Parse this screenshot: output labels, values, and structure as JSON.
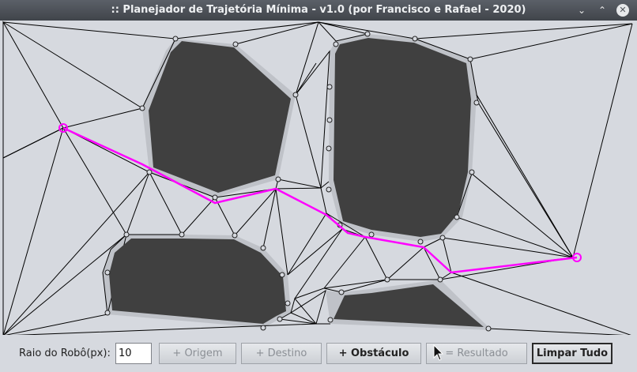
{
  "window": {
    "title": ":: Planejador de Trajetória Mínima - v1.0 (por Francisco e Rafael - 2020)",
    "minimize_glyph": "⌄",
    "maximize_glyph": "⌃",
    "close_glyph": "✕"
  },
  "toolbar": {
    "radius_label": "Raio do Robô(px):",
    "radius_value": "10",
    "origin_button": "+ Origem",
    "destination_button": "+ Destino",
    "obstacle_button": "+ Obstáculo",
    "result_button": "= Resultado",
    "clear_button": "Limpar Tudo"
  },
  "colors": {
    "obstacle_fill": "#404040",
    "obstacle_margin": "#bfc2c8",
    "path": "#ff00ff",
    "edges": "#000000",
    "background": "#d6d9df"
  }
}
